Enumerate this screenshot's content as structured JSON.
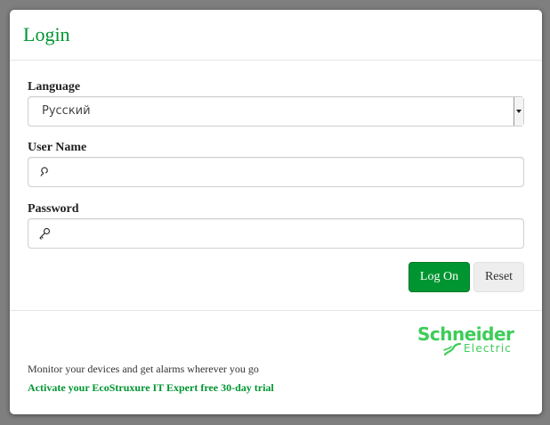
{
  "dialog": {
    "title": "Login"
  },
  "form": {
    "language": {
      "label": "Language",
      "selected": "Русский"
    },
    "username": {
      "label": "User Name",
      "value": "",
      "icon": "user-icon"
    },
    "password": {
      "label": "Password",
      "value": "",
      "icon": "key-icon"
    },
    "buttons": {
      "logon_label": "Log On",
      "reset_label": "Reset"
    }
  },
  "footer": {
    "logo": {
      "wordmark": "Schneider",
      "subtext": "Electric"
    },
    "tagline": "Monitor your devices and get alarms wherever you go",
    "trial_link": "Activate your EcoStruxure IT Expert free 30-day trial"
  },
  "colors": {
    "brand_green": "#009530",
    "logo_green": "#3dcd58",
    "backdrop": "#7f7f7f"
  }
}
